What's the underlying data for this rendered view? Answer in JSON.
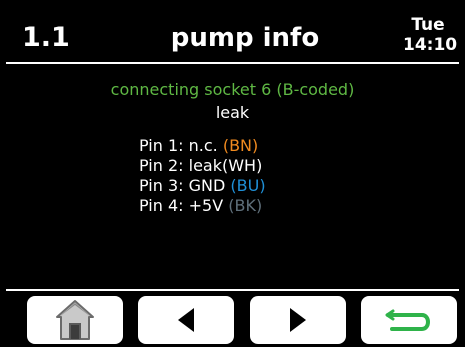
{
  "header": {
    "menu_number": "1.1",
    "title": "pump info",
    "day": "Tue",
    "time": "14:10"
  },
  "content": {
    "socket_heading": "connecting socket 6 (B-coded)",
    "sensor_label": "leak",
    "pins": [
      {
        "text": "Pin 1: n.c. ",
        "color_code": "(BN)",
        "color": "#f08a1f"
      },
      {
        "text": "Pin 2: leak(WH)",
        "color_code": "",
        "color": "#ffffff"
      },
      {
        "text": "Pin 3: GND ",
        "color_code": "(BU)",
        "color": "#1f8fd6"
      },
      {
        "text": "Pin 4: +5V ",
        "color_code": "(BK)",
        "color": "#5f6f7a"
      }
    ]
  },
  "footer": {
    "buttons": [
      {
        "icon": "home-icon"
      },
      {
        "icon": "arrow-left-icon"
      },
      {
        "icon": "arrow-right-icon"
      },
      {
        "icon": "back-return-icon"
      }
    ]
  },
  "colors": {
    "background": "#000000",
    "heading_green": "#5fb844",
    "return_green": "#2fb34a"
  }
}
